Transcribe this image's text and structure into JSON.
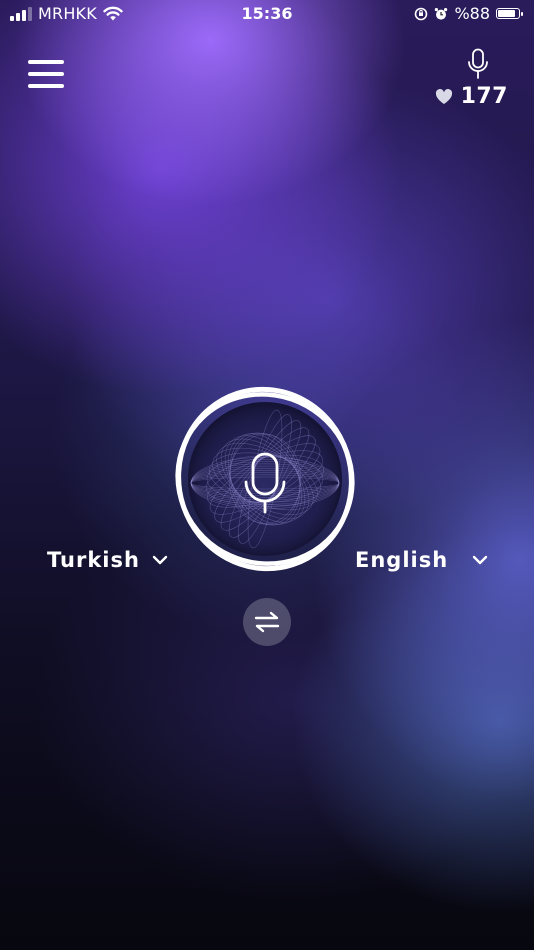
{
  "status_bar": {
    "carrier": "MRHKK",
    "time": "15:36",
    "battery_text": "%88",
    "battery_level": 0.88,
    "icons": [
      "signal-icon",
      "wifi-icon",
      "orientation-lock-icon",
      "alarm-icon",
      "battery-icon"
    ]
  },
  "header": {
    "menu_icon": "hamburger-menu-icon",
    "credits_icon": "microphone-icon",
    "credits_heart_icon": "heart-icon",
    "credits_count": "177"
  },
  "main": {
    "mic_icon": "microphone-icon",
    "source_language": "Turkish",
    "target_language": "English",
    "dropdown_icon": "chevron-down-icon",
    "swap_icon": "swap-arrows-icon"
  },
  "colors": {
    "accent_purple": "#8a5cf0",
    "deep_background": "#07070f",
    "swap_button_bg": "rgba(255,255,255,0.22)"
  }
}
